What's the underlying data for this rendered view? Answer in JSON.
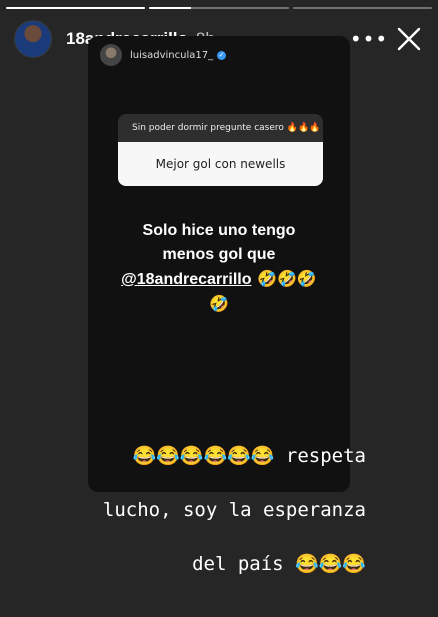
{
  "story": {
    "progress": [
      1,
      0.3,
      0
    ],
    "username": "18andrecarrillo",
    "time": "8h",
    "more_label": "•••"
  },
  "shared_post": {
    "username": "luisadvincula17_",
    "question": {
      "prompt": "Sin poder dormir pregunte casero 🔥🔥🔥",
      "answer": "Mejor gol con newells"
    },
    "reply": {
      "line1": "Solo hice uno tengo",
      "line2": "menos gol que",
      "mention": "@18andrecarrillo",
      "emojis_inline": " 🤣🤣🤣",
      "emoji_line": "🤣"
    }
  },
  "caption": {
    "line1": "😂😂😂😂😂😂 respeta",
    "line2": "lucho, soy la esperanza",
    "line3": "del país 😂😂😂"
  }
}
